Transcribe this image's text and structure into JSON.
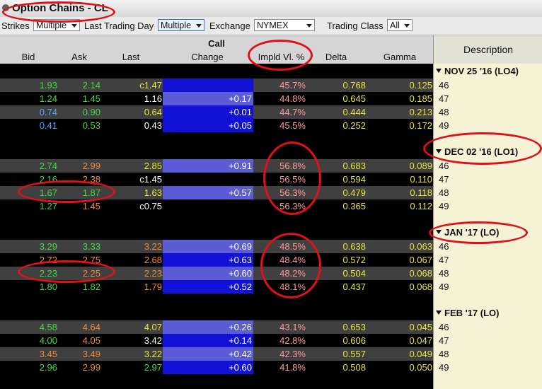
{
  "window": {
    "title": "Option Chains - CL"
  },
  "toolbar": {
    "strikes_label": "Strikes",
    "strikes_value": "Multiple",
    "ltd_label": "Last Trading Day",
    "ltd_value": "Multiple",
    "exchange_label": "Exchange",
    "exchange_value": "NYMEX",
    "trading_class_label": "Trading Class",
    "trading_class_value": "All"
  },
  "table": {
    "group_header": "Call",
    "columns": [
      "Bid",
      "Ask",
      "Last",
      "Change",
      "Impld Vl. %",
      "Delta",
      "Gamma"
    ],
    "description_header": "Description",
    "expirations": [
      {
        "label": "NOV 25 '16 (LO4)",
        "rows": [
          {
            "strike": "46",
            "bid": "1.93",
            "ask": "2.14",
            "last": "c1.47",
            "change": "",
            "iv": "45.7%",
            "delta": "0.768",
            "gamma": "0.125"
          },
          {
            "strike": "47",
            "bid": "1.24",
            "ask": "1.45",
            "last": "1.16",
            "change": "+0.17",
            "iv": "44.8%",
            "delta": "0.645",
            "gamma": "0.185"
          },
          {
            "strike": "48",
            "bid": "0.74",
            "ask": "0.90",
            "last": "0.64",
            "change": "+0.01",
            "iv": "44.7%",
            "delta": "0.444",
            "gamma": "0.213"
          },
          {
            "strike": "49",
            "bid": "0.41",
            "ask": "0.53",
            "last": "0.43",
            "change": "+0.05",
            "iv": "45.5%",
            "delta": "0.252",
            "gamma": "0.172"
          }
        ]
      },
      {
        "label": "DEC 02 '16 (LO1)",
        "rows": [
          {
            "strike": "46",
            "bid": "2.74",
            "ask": "2.99",
            "last": "2.85",
            "change": "+0.91",
            "iv": "56.8%",
            "delta": "0.683",
            "gamma": "0.089"
          },
          {
            "strike": "47",
            "bid": "2.16",
            "ask": "2.38",
            "last": "c1.45",
            "change": "",
            "iv": "56.5%",
            "delta": "0.594",
            "gamma": "0.110"
          },
          {
            "strike": "48",
            "bid": "1.67",
            "ask": "1.87",
            "last": "1.63",
            "change": "+0.57",
            "iv": "56.3%",
            "delta": "0.479",
            "gamma": "0.118"
          },
          {
            "strike": "49",
            "bid": "1.27",
            "ask": "1.45",
            "last": "c0.75",
            "change": "",
            "iv": "56.3%",
            "delta": "0.365",
            "gamma": "0.112"
          }
        ]
      },
      {
        "label": "JAN '17 (LO)",
        "rows": [
          {
            "strike": "46",
            "bid": "3.29",
            "ask": "3.33",
            "last": "3.22",
            "change": "+0.69",
            "iv": "48.5%",
            "delta": "0.638",
            "gamma": "0.063"
          },
          {
            "strike": "47",
            "bid": "2.72",
            "ask": "2.75",
            "last": "2.68",
            "change": "+0.63",
            "iv": "48.4%",
            "delta": "0.572",
            "gamma": "0.067"
          },
          {
            "strike": "48",
            "bid": "2.23",
            "ask": "2.25",
            "last": "2.23",
            "change": "+0.60",
            "iv": "48.2%",
            "delta": "0.504",
            "gamma": "0.068"
          },
          {
            "strike": "49",
            "bid": "1.80",
            "ask": "1.82",
            "last": "1.79",
            "change": "+0.52",
            "iv": "48.1%",
            "delta": "0.437",
            "gamma": "0.068"
          }
        ]
      },
      {
        "label": "FEB '17 (LO)",
        "rows": [
          {
            "strike": "46",
            "bid": "4.58",
            "ask": "4.64",
            "last": "4.07",
            "change": "+0.26",
            "iv": "43.1%",
            "delta": "0.653",
            "gamma": "0.045"
          },
          {
            "strike": "47",
            "bid": "4.00",
            "ask": "4.05",
            "last": "3.42",
            "change": "+0.14",
            "iv": "42.8%",
            "delta": "0.606",
            "gamma": "0.047"
          },
          {
            "strike": "48",
            "bid": "3.45",
            "ask": "3.49",
            "last": "3.22",
            "change": "+0.42",
            "iv": "42.3%",
            "delta": "0.557",
            "gamma": "0.049"
          },
          {
            "strike": "49",
            "bid": "2.96",
            "ask": "2.99",
            "last": "2.97",
            "change": "+0.60",
            "iv": "41.8%",
            "delta": "0.508",
            "gamma": "0.050"
          }
        ]
      }
    ]
  },
  "colors": {
    "bid_ask_green": "#3dde3d",
    "bid_ask_blue": "#4aa6ff",
    "orange": "#f08a3c",
    "last_yellow": "#e8e83a",
    "iv_pink": "#ff9a9a",
    "change_bg": "#1212d6",
    "annotation_red": "#e0101a"
  }
}
